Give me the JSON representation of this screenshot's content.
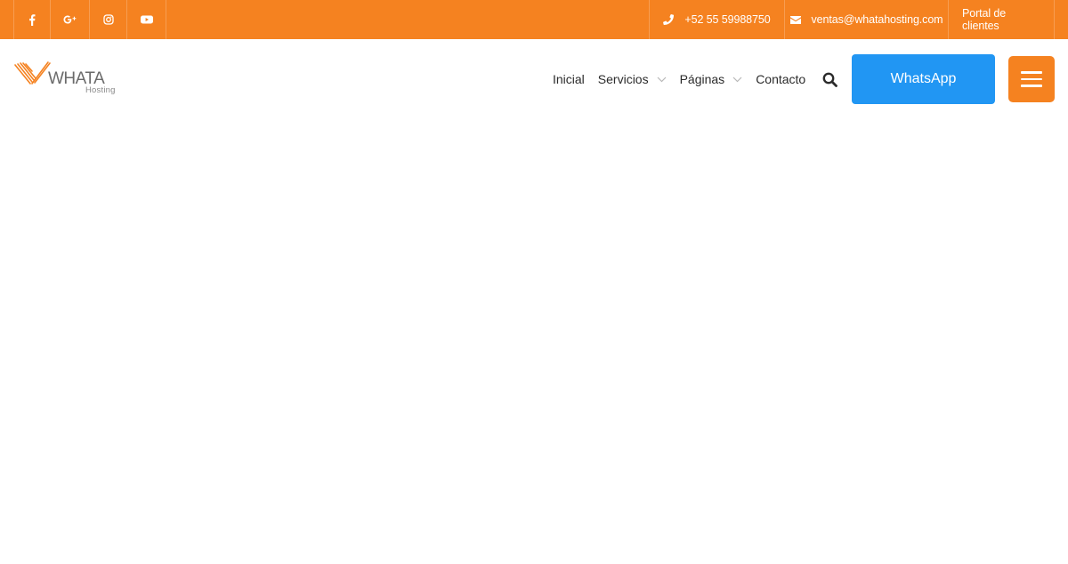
{
  "colors": {
    "brand_orange": "#f58220",
    "whatsapp_blue": "#2196f3",
    "nav_text": "#2b2b2b"
  },
  "topbar": {
    "social": [
      {
        "name": "facebook",
        "icon": "facebook-icon"
      },
      {
        "name": "google-plus",
        "icon": "google-plus-icon"
      },
      {
        "name": "instagram",
        "icon": "instagram-icon"
      },
      {
        "name": "youtube",
        "icon": "youtube-icon"
      }
    ],
    "phone": {
      "icon": "phone-icon",
      "text": "+52 55 59988750"
    },
    "email": {
      "icon": "envelope-icon",
      "text": "ventas@whatahosting.com"
    },
    "portal": {
      "text": "Portal de clientes"
    }
  },
  "header": {
    "logo": {
      "word": "WHATA",
      "sub": "Hosting"
    },
    "nav": [
      {
        "label": "Inicial",
        "has_dropdown": false
      },
      {
        "label": "Servicios",
        "has_dropdown": true
      },
      {
        "label": "Páginas",
        "has_dropdown": true
      },
      {
        "label": "Contacto",
        "has_dropdown": false
      }
    ],
    "search_icon": "search-icon",
    "whatsapp_label": "WhatsApp",
    "menu_icon": "hamburger-menu-icon"
  }
}
